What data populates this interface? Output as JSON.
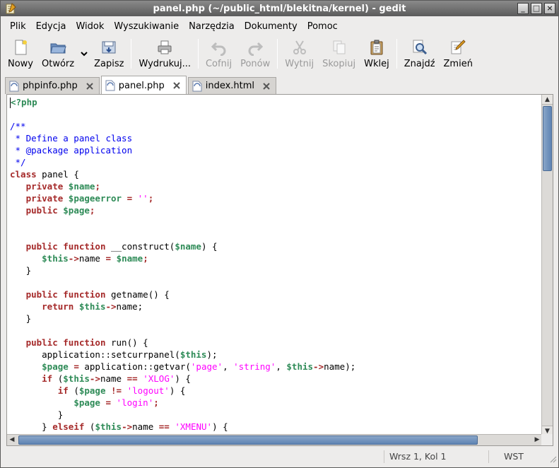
{
  "window": {
    "title": "panel.php (~/public_html/blekitna/kernel) - gedit",
    "controls": [
      "minimize",
      "maximize",
      "close"
    ]
  },
  "menu": [
    "Plik",
    "Edycja",
    "Widok",
    "Wyszukiwanie",
    "Narzędzia",
    "Dokumenty",
    "Pomoc"
  ],
  "toolbar": {
    "new": "Nowy",
    "open": "Otwórz",
    "save": "Zapisz",
    "print": "Wydrukuj...",
    "undo": "Cofnij",
    "redo": "Ponów",
    "cut": "Wytnij",
    "copy": "Skopiuj",
    "paste": "Wklej",
    "find": "Znajdź",
    "replace": "Zmień"
  },
  "tabs": [
    {
      "label": "phpinfo.php",
      "active": false
    },
    {
      "label": "panel.php",
      "active": true
    },
    {
      "label": "index.html",
      "active": false
    }
  ],
  "code_lines": [
    [
      [
        "pre",
        "<?php"
      ]
    ],
    [],
    [
      [
        "cmt",
        "/**"
      ]
    ],
    [
      [
        "cmt",
        " * Define a panel class"
      ]
    ],
    [
      [
        "cmt",
        " * @package application"
      ]
    ],
    [
      [
        "cmt",
        " */"
      ]
    ],
    [
      [
        "kw",
        "class"
      ],
      [
        "",
        " panel {"
      ]
    ],
    [
      [
        "",
        "   "
      ],
      [
        "kw",
        "private"
      ],
      [
        "",
        " "
      ],
      [
        "var",
        "$name"
      ],
      [
        "op",
        ";"
      ]
    ],
    [
      [
        "",
        "   "
      ],
      [
        "kw",
        "private"
      ],
      [
        "",
        " "
      ],
      [
        "var",
        "$pageerror"
      ],
      [
        "",
        " "
      ],
      [
        "op",
        "="
      ],
      [
        "",
        " "
      ],
      [
        "str",
        "''"
      ],
      [
        "op",
        ";"
      ]
    ],
    [
      [
        "",
        "   "
      ],
      [
        "kw",
        "public"
      ],
      [
        "",
        " "
      ],
      [
        "var",
        "$page"
      ],
      [
        "op",
        ";"
      ]
    ],
    [],
    [],
    [
      [
        "",
        "   "
      ],
      [
        "kw",
        "public"
      ],
      [
        "",
        " "
      ],
      [
        "kw",
        "function"
      ],
      [
        "",
        " __construct("
      ],
      [
        "var",
        "$name"
      ],
      [
        "",
        ") {"
      ]
    ],
    [
      [
        "",
        "      "
      ],
      [
        "var",
        "$this"
      ],
      [
        "op",
        "->"
      ],
      [
        "",
        "name "
      ],
      [
        "op",
        "="
      ],
      [
        "",
        " "
      ],
      [
        "var",
        "$name"
      ],
      [
        "op",
        ";"
      ]
    ],
    [
      [
        "",
        "   }"
      ]
    ],
    [],
    [
      [
        "",
        "   "
      ],
      [
        "kw",
        "public"
      ],
      [
        "",
        " "
      ],
      [
        "kw",
        "function"
      ],
      [
        "",
        " getname() {"
      ]
    ],
    [
      [
        "",
        "      "
      ],
      [
        "kw",
        "return"
      ],
      [
        "",
        " "
      ],
      [
        "var",
        "$this"
      ],
      [
        "op",
        "->"
      ],
      [
        "",
        "name;"
      ]
    ],
    [
      [
        "",
        "   }"
      ]
    ],
    [],
    [
      [
        "",
        "   "
      ],
      [
        "kw",
        "public"
      ],
      [
        "",
        " "
      ],
      [
        "kw",
        "function"
      ],
      [
        "",
        " run() {"
      ]
    ],
    [
      [
        "",
        "      application::setcurrpanel("
      ],
      [
        "var",
        "$this"
      ],
      [
        "",
        ");"
      ]
    ],
    [
      [
        "",
        "      "
      ],
      [
        "var",
        "$page"
      ],
      [
        "",
        " "
      ],
      [
        "op",
        "="
      ],
      [
        "",
        " application::getvar("
      ],
      [
        "str",
        "'page'"
      ],
      [
        "",
        ", "
      ],
      [
        "str",
        "'string'"
      ],
      [
        "",
        ", "
      ],
      [
        "var",
        "$this"
      ],
      [
        "op",
        "->"
      ],
      [
        "",
        "name);"
      ]
    ],
    [
      [
        "",
        "      "
      ],
      [
        "kw",
        "if"
      ],
      [
        "",
        " ("
      ],
      [
        "var",
        "$this"
      ],
      [
        "op",
        "->"
      ],
      [
        "",
        "name "
      ],
      [
        "op",
        "=="
      ],
      [
        "",
        " "
      ],
      [
        "str",
        "'XLOG'"
      ],
      [
        "",
        ") {"
      ]
    ],
    [
      [
        "",
        "         "
      ],
      [
        "kw",
        "if"
      ],
      [
        "",
        " ("
      ],
      [
        "var",
        "$page"
      ],
      [
        "",
        " "
      ],
      [
        "op",
        "!="
      ],
      [
        "",
        " "
      ],
      [
        "str",
        "'logout'"
      ],
      [
        "",
        ") {"
      ]
    ],
    [
      [
        "",
        "            "
      ],
      [
        "var",
        "$page"
      ],
      [
        "",
        " "
      ],
      [
        "op",
        "="
      ],
      [
        "",
        " "
      ],
      [
        "str",
        "'login'"
      ],
      [
        "op",
        ";"
      ]
    ],
    [
      [
        "",
        "         }"
      ]
    ],
    [
      [
        "",
        "      } "
      ],
      [
        "kw",
        "elseif"
      ],
      [
        "",
        " ("
      ],
      [
        "var",
        "$this"
      ],
      [
        "op",
        "->"
      ],
      [
        "",
        "name "
      ],
      [
        "op",
        "=="
      ],
      [
        "",
        " "
      ],
      [
        "str",
        "'XMENU'"
      ],
      [
        "",
        ") {"
      ]
    ]
  ],
  "status": {
    "position": "Wrsz 1, Kol 1",
    "mode": "WST"
  }
}
